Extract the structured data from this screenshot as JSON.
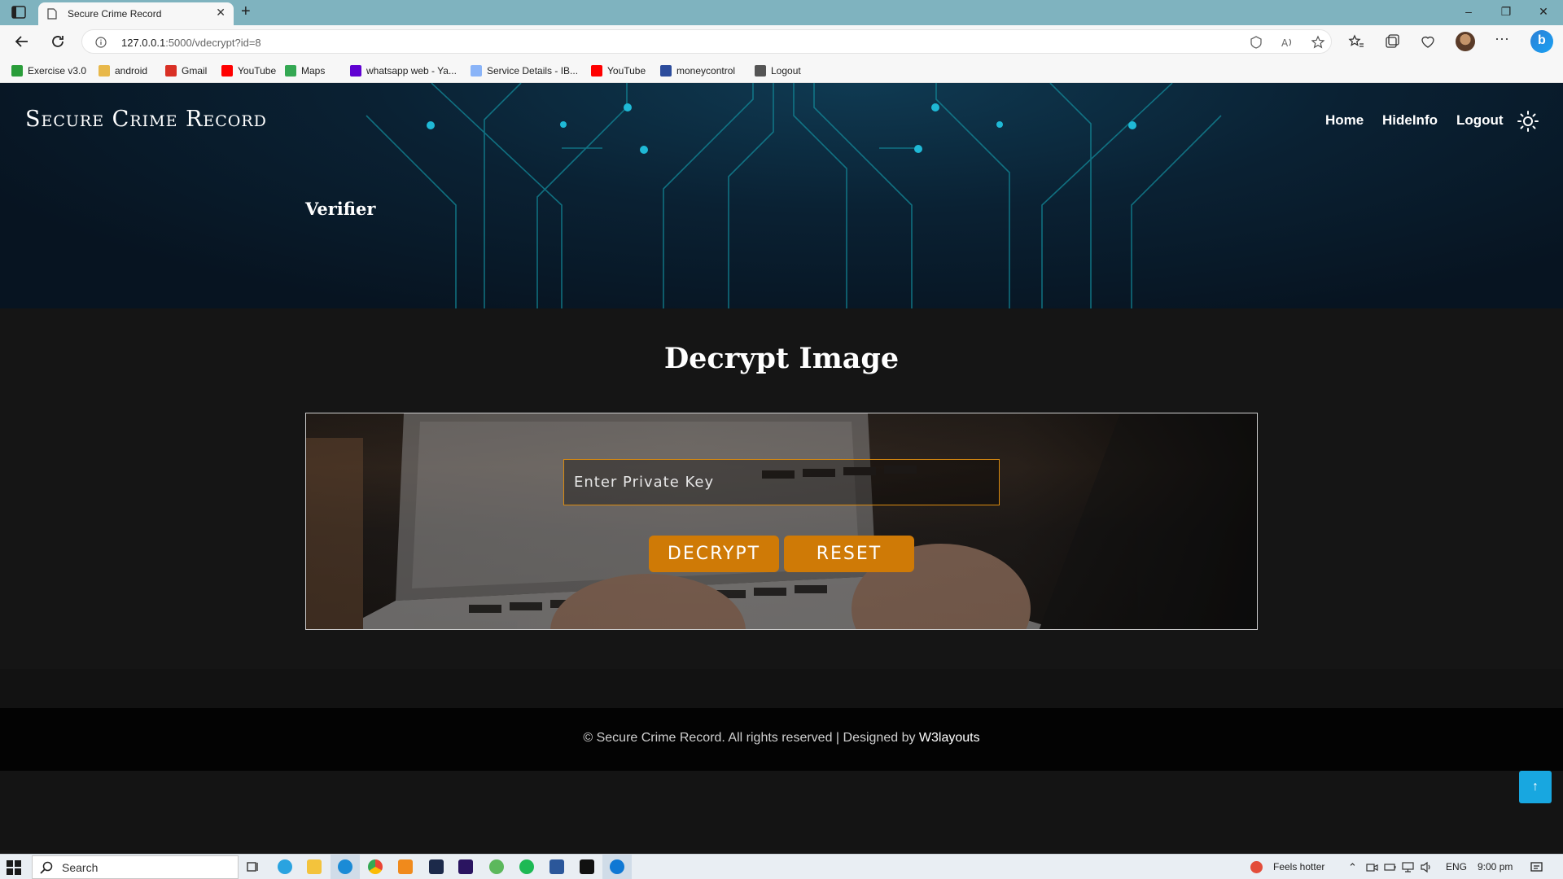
{
  "browser": {
    "tab_title": "Secure Crime Record",
    "url_host": "127.0.0.1",
    "url_rest": ":5000/vdecrypt?id=8",
    "bookmarks": [
      {
        "label": "Exercise v3.0",
        "icon": "w-icon",
        "color": "#2a9d3a"
      },
      {
        "label": "android",
        "icon": "folder-icon",
        "color": "#e8b84a"
      },
      {
        "label": "Gmail",
        "icon": "gmail-icon",
        "color": "#d93025"
      },
      {
        "label": "YouTube",
        "icon": "youtube-icon",
        "color": "#ff0000"
      },
      {
        "label": "Maps",
        "icon": "maps-pin-icon",
        "color": "#34a853"
      },
      {
        "label": "whatsapp web - Ya...",
        "icon": "yahoo-icon",
        "color": "#6001d2"
      },
      {
        "label": "Service Details - IB...",
        "icon": "cloud-icon",
        "color": "#8ab4f8"
      },
      {
        "label": "YouTube",
        "icon": "youtube-icon",
        "color": "#ff0000"
      },
      {
        "label": "moneycontrol",
        "icon": "moneycontrol-icon",
        "color": "#2c4c9c"
      },
      {
        "label": "Logout",
        "icon": "page-icon",
        "color": "#555555"
      }
    ]
  },
  "site": {
    "brand": "Secure Crime Record",
    "nav": {
      "home": "Home",
      "hideinfo": "HideInfo",
      "logout": "Logout"
    },
    "hero_title": "Verifier"
  },
  "main": {
    "title": "Decrypt Image",
    "key_placeholder": "Enter Private Key",
    "decrypt_label": "DECRYPT",
    "reset_label": "RESET"
  },
  "footer": {
    "text": "© Secure Crime Record. All rights reserved | Designed by ",
    "link": "W3layouts"
  },
  "to_top_icon": "↑",
  "taskbar": {
    "search_label": "Search",
    "weather": "Feels hotter",
    "lang": "ENG",
    "time": "9:00 pm"
  },
  "colors": {
    "accent_button": "#cf7a06",
    "input_border": "#d98a10",
    "to_top": "#18a7e0"
  }
}
